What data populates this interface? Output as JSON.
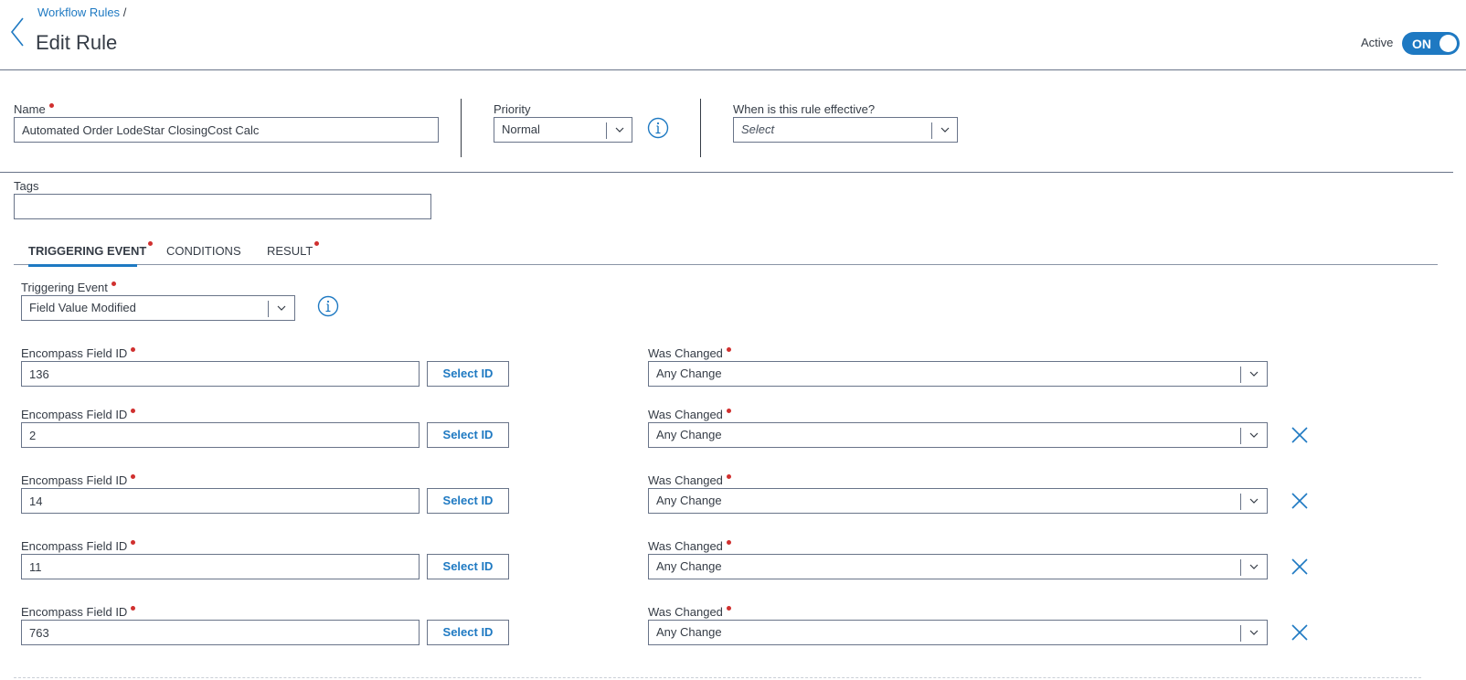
{
  "header": {
    "breadcrumb_link": "Workflow Rules",
    "breadcrumb_sep": "/",
    "title": "Edit Rule",
    "active_label": "Active",
    "toggle_label": "ON"
  },
  "form": {
    "name_label": "Name",
    "name_value": "Automated Order LodeStar ClosingCost Calc",
    "priority_label": "Priority",
    "priority_value": "Normal",
    "effective_label": "When is this rule effective?",
    "effective_placeholder": "Select",
    "tags_label": "Tags",
    "tags_value": ""
  },
  "tabs": [
    {
      "label": "TRIGGERING EVENT"
    },
    {
      "label": "CONDITIONS"
    },
    {
      "label": "RESULT"
    }
  ],
  "trigger": {
    "label": "Triggering Event",
    "value": "Field Value Modified"
  },
  "fields": {
    "field_label": "Encompass Field ID",
    "changed_label": "Was Changed",
    "select_button": "Select ID",
    "rows": [
      {
        "id": "136",
        "changed": "Any Change"
      },
      {
        "id": "2",
        "changed": "Any Change"
      },
      {
        "id": "14",
        "changed": "Any Change"
      },
      {
        "id": "11",
        "changed": "Any Change"
      },
      {
        "id": "763",
        "changed": "Any Change"
      }
    ]
  },
  "colors": {
    "accent": "#1e79c2",
    "required": "#d0302f",
    "text": "#353c46",
    "border": "#697489"
  }
}
